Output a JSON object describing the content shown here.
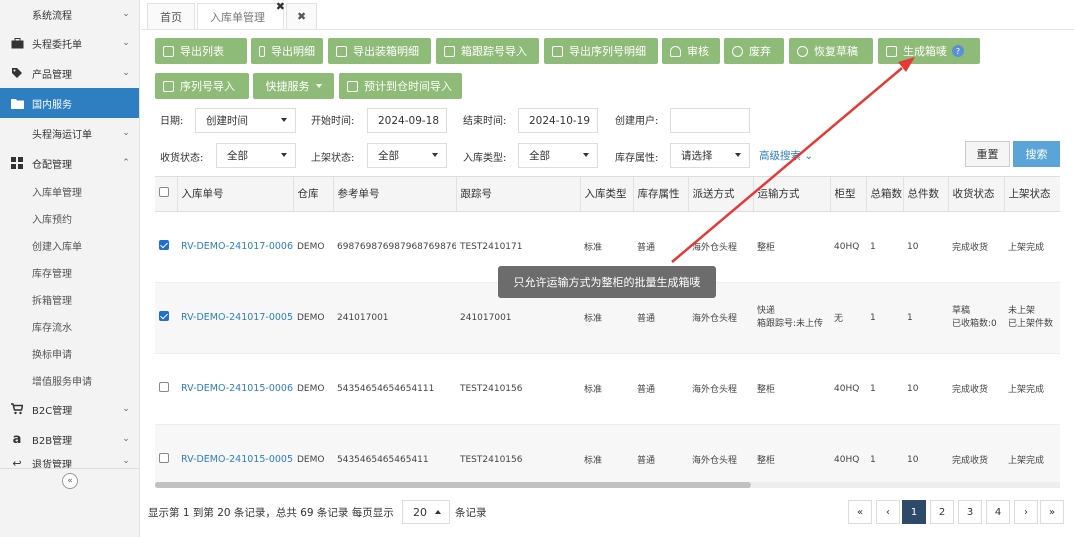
{
  "sidebar": {
    "top_item": "系统流程",
    "items": [
      {
        "label": "头程委托单",
        "icon": "briefcase-icon"
      },
      {
        "label": "产品管理",
        "icon": "tag-icon"
      },
      {
        "label": "国内服务",
        "icon": "folder-icon"
      },
      {
        "label": "头程海运订单",
        "icon": ""
      },
      {
        "label": "仓配管理",
        "icon": "grid-icon"
      }
    ],
    "warehouse_sub": [
      "入库单管理",
      "入库预约",
      "创建入库单",
      "库存管理",
      "拆箱管理",
      "库存流水",
      "换标申请",
      "增值服务申请"
    ],
    "bottom_items": [
      {
        "label": "B2C管理",
        "icon": "cart-icon"
      },
      {
        "label": "B2B管理",
        "icon": "amazon-icon"
      },
      {
        "label": "退货管理",
        "icon": "return-icon"
      }
    ],
    "collapse_symbol": "«"
  },
  "tabs": [
    {
      "label": "首页"
    },
    {
      "label": "入库单管理",
      "close": "✖"
    },
    {
      "label": "✖"
    }
  ],
  "toolbar": {
    "row1": [
      "导出列表",
      "导出明细",
      "导出装箱明细",
      "箱跟踪号导入",
      "导出序列号明细",
      "审核",
      "废弃",
      "恢复草稿",
      "生成箱唛"
    ],
    "help": "?",
    "row2": [
      "序列号导入",
      "快捷服务",
      "预计到仓时间导入"
    ]
  },
  "filters": {
    "date_label": "日期:",
    "date_type": "创建时间",
    "start_label": "开始时间:",
    "start_value": "2024-09-18",
    "end_label": "结束时间:",
    "end_value": "2024-10-19",
    "user_label": "创建用户:",
    "user_value": "",
    "receive_label": "收货状态:",
    "receive_value": "全部",
    "shelf_label": "上架状态:",
    "shelf_value": "全部",
    "type_label": "入库类型:",
    "type_value": "全部",
    "attr_label": "库存属性:",
    "attr_value": "请选择",
    "advanced": "高级搜索",
    "reset": "重置",
    "search": "搜索"
  },
  "table": {
    "headers": [
      "入库单号",
      "仓库",
      "参考单号",
      "跟踪号",
      "入库类型",
      "库存属性",
      "派送方式",
      "运输方式",
      "柜型",
      "总箱数",
      "总件数",
      "收货状态",
      "上架状态"
    ],
    "rows": [
      {
        "checked": true,
        "cells": [
          "RV-DEMO-241017-0006",
          "DEMO",
          "698769876987968769876987",
          "TEST2410171",
          "标准",
          "普通",
          "海外仓头程",
          "整柜",
          "40HQ",
          "1",
          "10",
          "完成收货",
          "上架完成"
        ]
      },
      {
        "checked": true,
        "cells": [
          "RV-DEMO-241017-0005",
          "DEMO",
          "241017001",
          "241017001",
          "标准",
          "普通",
          "海外仓头程",
          "快递\n箱跟踪号:未上传",
          "无",
          "1",
          "1",
          "草稿\n已收箱数:0",
          "未上架\n已上架件数"
        ]
      },
      {
        "checked": false,
        "cells": [
          "RV-DEMO-241015-0006",
          "DEMO",
          "54354654654654111",
          "TEST2410156",
          "标准",
          "普通",
          "海外仓头程",
          "整柜",
          "40HQ",
          "1",
          "10",
          "完成收货",
          "上架完成"
        ]
      },
      {
        "checked": false,
        "cells": [
          "RV-DEMO-241015-0005",
          "DEMO",
          "5435465465465411",
          "TEST2410156",
          "标准",
          "普通",
          "海外仓头程",
          "整柜",
          "40HQ",
          "1",
          "10",
          "完成收货",
          "上架完成"
        ]
      }
    ]
  },
  "toast": "只允许运输方式为整柜的批量生成箱唛",
  "footer": {
    "summary": "显示第 1 到第 20 条记录，总共 69 条记录 每页显示",
    "page_size": "20",
    "suffix": "条记录",
    "pages": [
      "«",
      "‹",
      "1",
      "2",
      "3",
      "4",
      "›",
      "»"
    ],
    "current_page": "1"
  },
  "colors": {
    "accent": "#2d7fc1",
    "toolbar_green": "#8fbb78",
    "annotation_red": "#e53935"
  }
}
